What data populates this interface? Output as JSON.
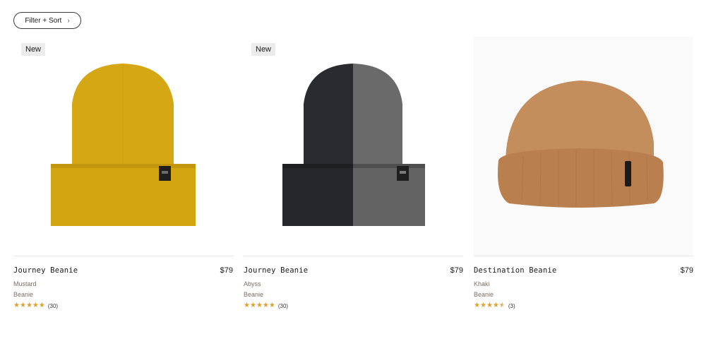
{
  "toolbar": {
    "filter_label": "Filter + Sort",
    "filter_chevron": "›"
  },
  "products": [
    {
      "badge": "New",
      "name": "Journey Beanie",
      "price": "$79",
      "color": "Mustard",
      "category": "Beanie",
      "rating": 5,
      "review_count": "(30)",
      "hat_colors": [
        "#d3a511",
        "#c89b0c"
      ]
    },
    {
      "badge": "New",
      "name": "Journey Beanie",
      "price": "$79",
      "color": "Abyss",
      "category": "Beanie",
      "rating": 5,
      "review_count": "(30)",
      "hat_colors": [
        "#2a2b2e",
        "#6a6a6a"
      ]
    },
    {
      "badge": "",
      "name": "Destination Beanie",
      "price": "$79",
      "color": "Khaki",
      "category": "Beanie",
      "rating": 4.5,
      "review_count": "(3)",
      "hat_colors": [
        "#c08a5a",
        "#b47e4f"
      ]
    }
  ],
  "colors": {
    "star": "#e0a030",
    "badge_bg": "#ececec",
    "meta_text": "#7b6e63"
  }
}
